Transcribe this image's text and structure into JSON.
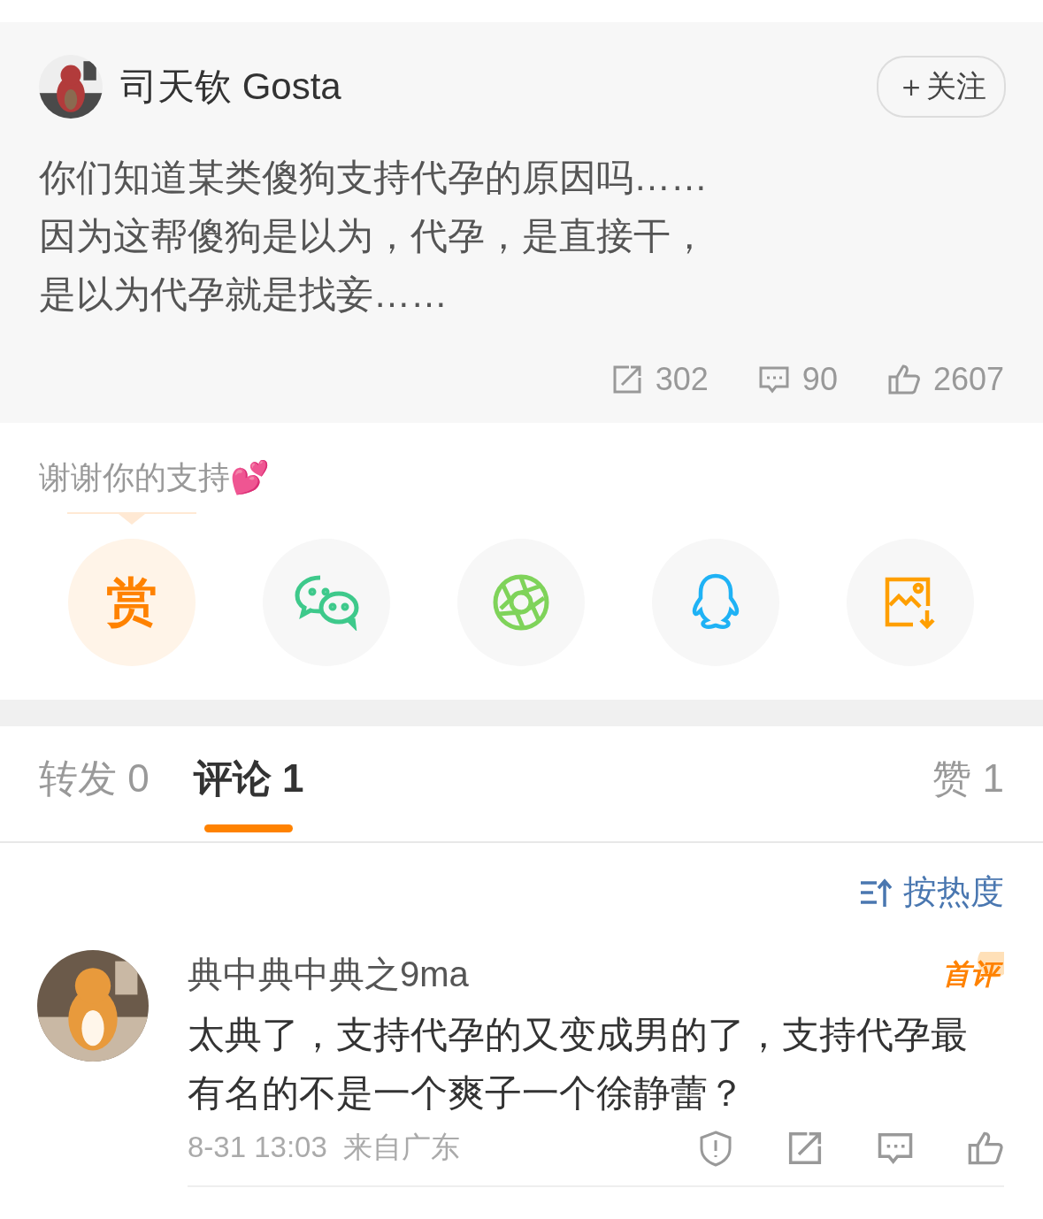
{
  "post": {
    "author": "司天钦 Gosta",
    "follow_button": "＋关注",
    "text_lines": [
      "你们知道某类傻狗支持代孕的原因吗……",
      "因为这帮傻狗是以为，代孕，是直接干，",
      "是以为代孕就是找妾……"
    ],
    "stats": [
      {
        "kind": "repost",
        "count": "302"
      },
      {
        "kind": "comment",
        "count": "90"
      },
      {
        "kind": "like",
        "count": "2607"
      }
    ]
  },
  "share": {
    "caption": "谢谢你的支持💕",
    "items": [
      {
        "kind": "reward",
        "label": "赏"
      },
      {
        "kind": "wechat"
      },
      {
        "kind": "moments"
      },
      {
        "kind": "qq"
      },
      {
        "kind": "save_image"
      }
    ]
  },
  "tabs": [
    {
      "label": "转发 0",
      "selected": false
    },
    {
      "label": "评论 1",
      "selected": true
    },
    {
      "label": "赞 1",
      "selected": false
    }
  ],
  "sort": {
    "label": "按热度"
  },
  "comments": [
    {
      "author": "典中典中典之9ma",
      "badge": "首评",
      "text": "太典了，支持代孕的又变成男的了，支持代孕最有名的不是一个爽子一个徐静蕾？",
      "time": "8-31 13:03",
      "source": "来自广东",
      "actions": [
        {
          "kind": "report"
        },
        {
          "kind": "repost"
        },
        {
          "kind": "comment"
        },
        {
          "kind": "like"
        }
      ]
    }
  ]
}
